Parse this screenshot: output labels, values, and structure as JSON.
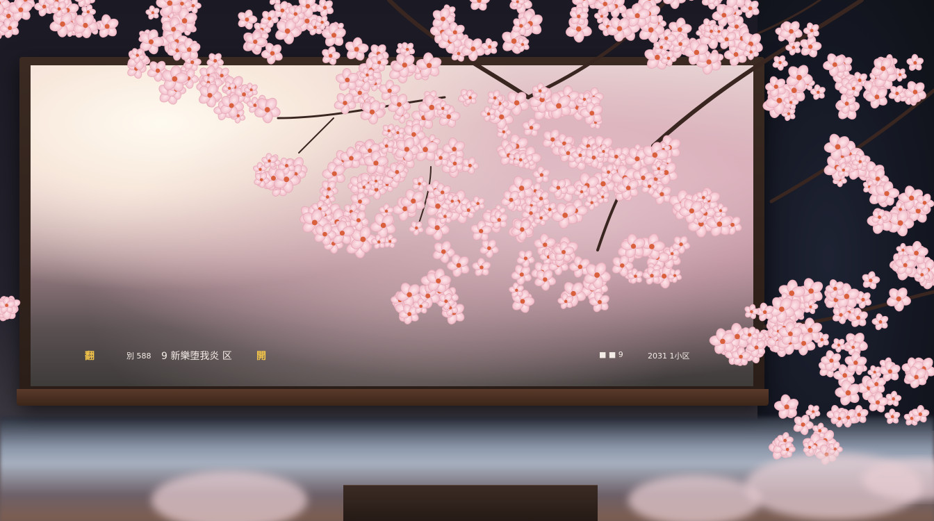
{
  "scene": {
    "subject": "cherry-blossom-tv-scene",
    "accent_petal": "#f3c4cf",
    "accent_center": "#d9603c",
    "branch_color": "#3a2620"
  },
  "screen_caption": {
    "left_icon": "翻",
    "left_text_1": "別 588",
    "left_text_2": "9 新樂堕我炎 区",
    "left_icon_2": "開",
    "right_text_1": "■ ■ 9",
    "right_text_2": "2031 1小区"
  }
}
